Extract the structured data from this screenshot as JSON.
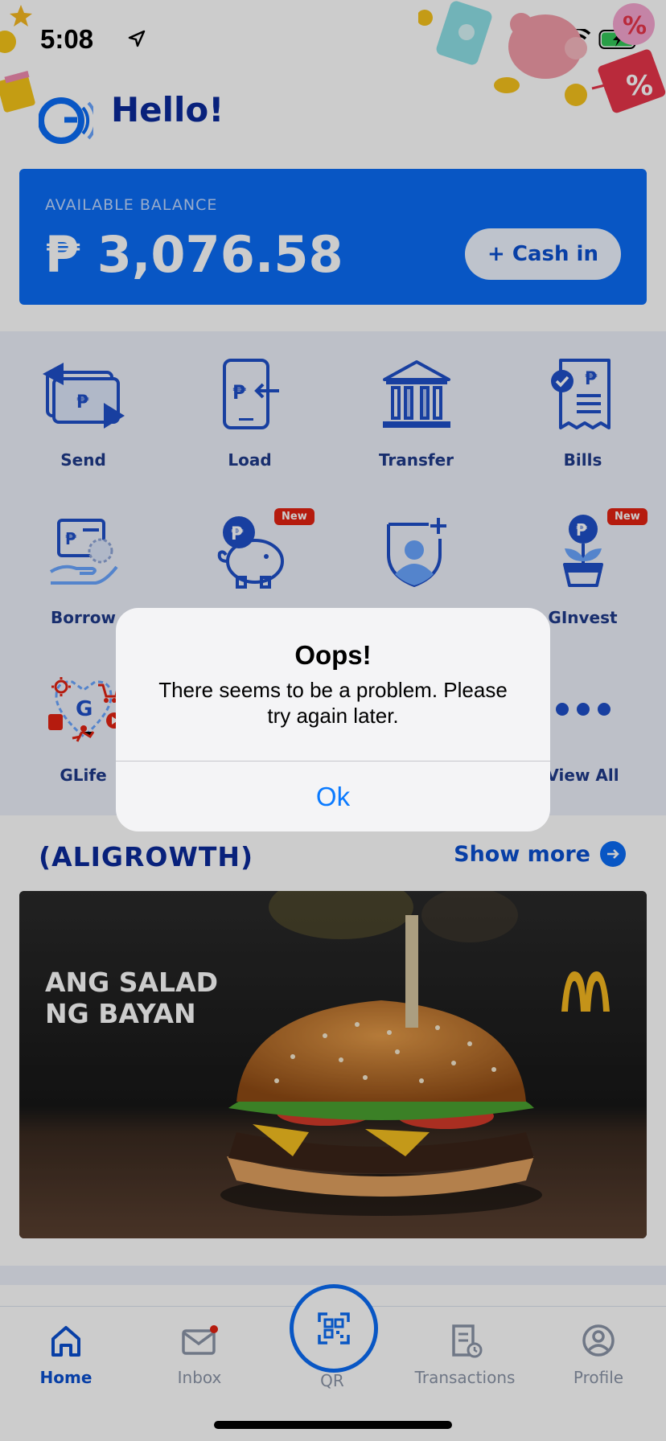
{
  "status": {
    "time": "5:08"
  },
  "header": {
    "greeting": "Hello!"
  },
  "balance": {
    "label": "AVAILABLE BALANCE",
    "amount": "₱ 3,076.58",
    "cashin_label": "+ Cash in"
  },
  "services": [
    {
      "label": "Send",
      "icon": "send-icon"
    },
    {
      "label": "Load",
      "icon": "load-icon"
    },
    {
      "label": "Transfer",
      "icon": "bank-icon"
    },
    {
      "label": "Bills",
      "icon": "bills-icon"
    },
    {
      "label": "Borrow",
      "icon": "borrow-icon"
    },
    {
      "label": "",
      "icon": "piggy-bank-icon",
      "badge": "New"
    },
    {
      "label": "",
      "icon": "insurance-icon"
    },
    {
      "label": "GInvest",
      "icon": "invest-plant-icon",
      "badge": "New"
    },
    {
      "label": "GLife",
      "icon": "glife-icon"
    },
    {
      "label": "View All",
      "icon": "more-icon"
    }
  ],
  "section": {
    "title": "(ALIGROWTH)",
    "show_more": "Show more",
    "banner_text_line1": "ANG SALAD",
    "banner_text_line2": "NG BAYAN"
  },
  "tabbar": {
    "items": [
      {
        "label": "Home",
        "icon": "home-icon"
      },
      {
        "label": "Inbox",
        "icon": "mail-icon"
      },
      {
        "label": "QR",
        "icon": "qr-scan-icon"
      },
      {
        "label": "Transactions",
        "icon": "transactions-icon"
      },
      {
        "label": "Profile",
        "icon": "profile-icon"
      }
    ]
  },
  "alert": {
    "title": "Oops!",
    "message": "There seems to be a problem. Please try again later.",
    "ok_label": "Ok"
  },
  "colors": {
    "brand": "#0a6cf5",
    "navy": "#0a2a9a",
    "badge": "#e32212",
    "ios_blue": "#0a7aff"
  }
}
